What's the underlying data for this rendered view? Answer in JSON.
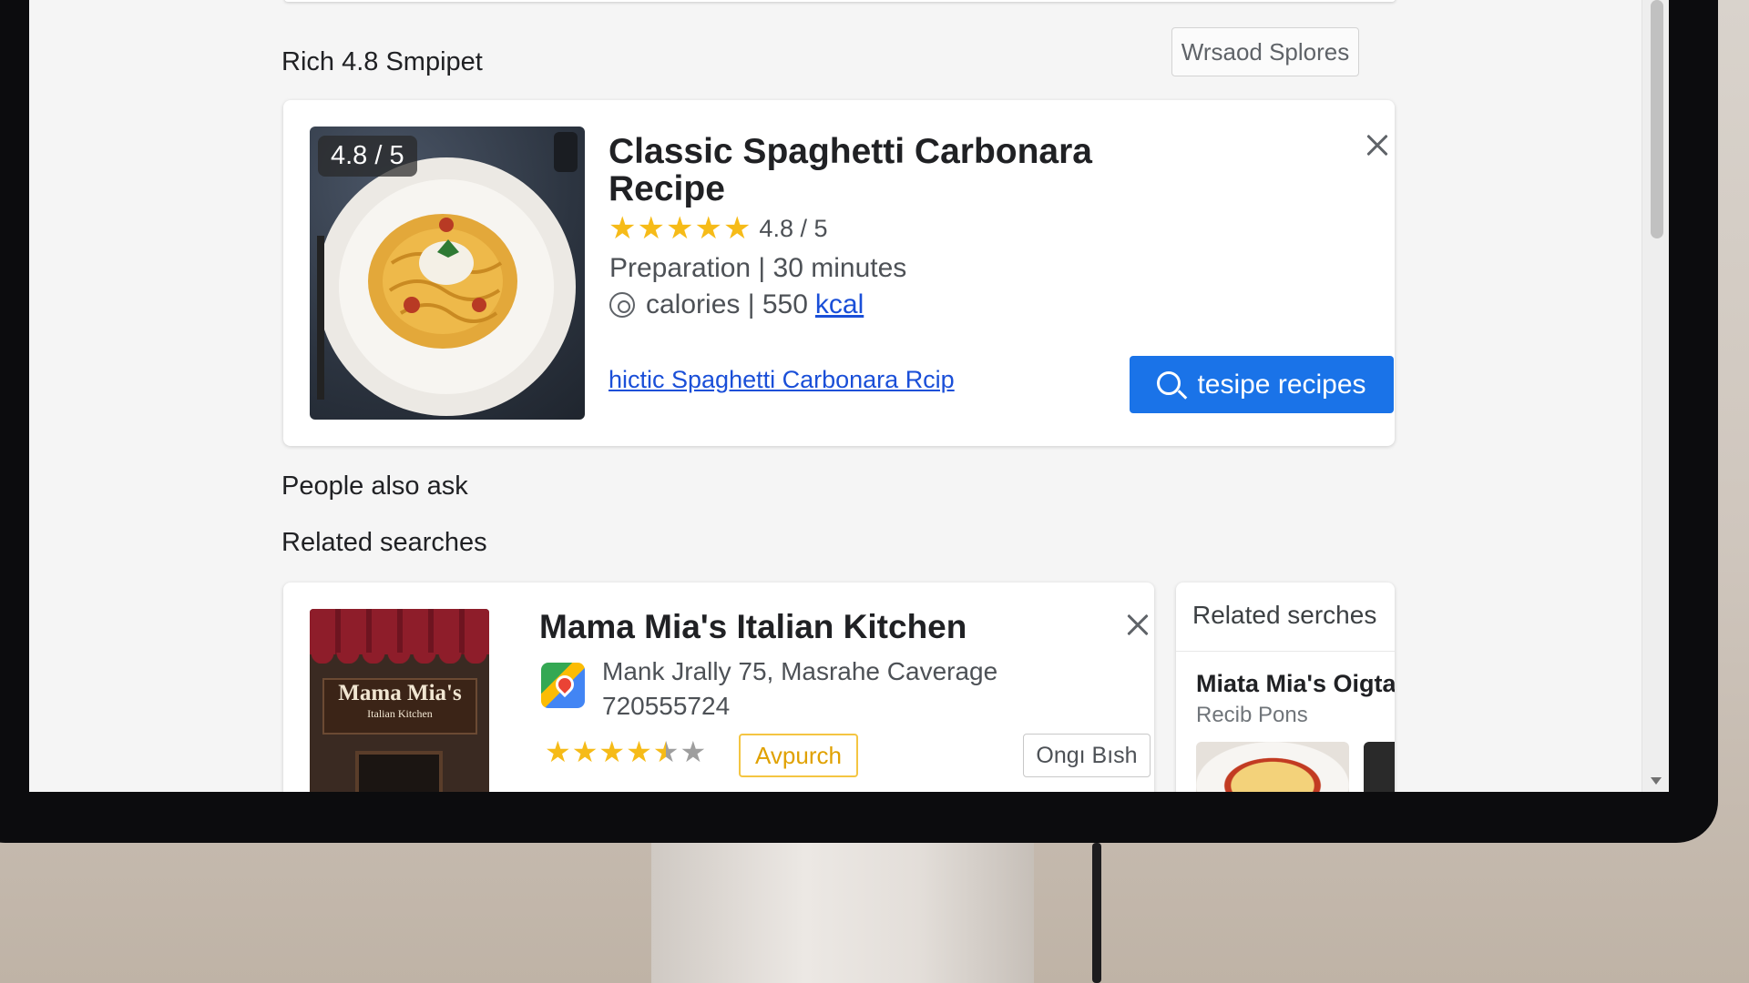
{
  "header": {
    "section_title": "Rich 4.8 Smpipet",
    "action_button": "Wrsaod Splores"
  },
  "recipe_card": {
    "rating_badge": "4.8 / 5",
    "title": "Classic Spaghetti Carbonara Recipe",
    "rating_value": 4.8,
    "rating_text": "4.8 / 5",
    "preparation": "Preparation | 30 minutes",
    "calories_label": "calories | 550",
    "calories_unit": "kcal",
    "link_text": "hictic Spaghetti Carbonara Rcip",
    "primary_button": "tesipe recipes",
    "icons": {
      "close": "close-icon",
      "search": "search-icon",
      "calories": "calorie-icon"
    }
  },
  "sections": {
    "people_also_ask": "People also ask",
    "related_searches": "Related searches"
  },
  "restaurant_card": {
    "image_sign_main": "Mama Mia's",
    "image_sign_sub": "Italian Kitchen",
    "title": "Mama Mia's Italian Kitchen",
    "address_line1": "Mank Jrally 75, Masrahe Caverage",
    "address_line2": "720555724",
    "rating_stars": 4.5,
    "chip_primary": "Avpurch",
    "chip_secondary": "Ongı Bısh",
    "icons": {
      "maps": "maps-icon",
      "close": "close-icon"
    }
  },
  "side_panel": {
    "header": "Related serches",
    "item_title": "Miata Mia's Oigtas",
    "item_subtitle": "Recib Pons"
  },
  "colors": {
    "accent_blue": "#1a73e8",
    "link_blue": "#1a4fd8",
    "star_yellow": "#f6bb18",
    "chip_yellow": "#f4c542"
  }
}
